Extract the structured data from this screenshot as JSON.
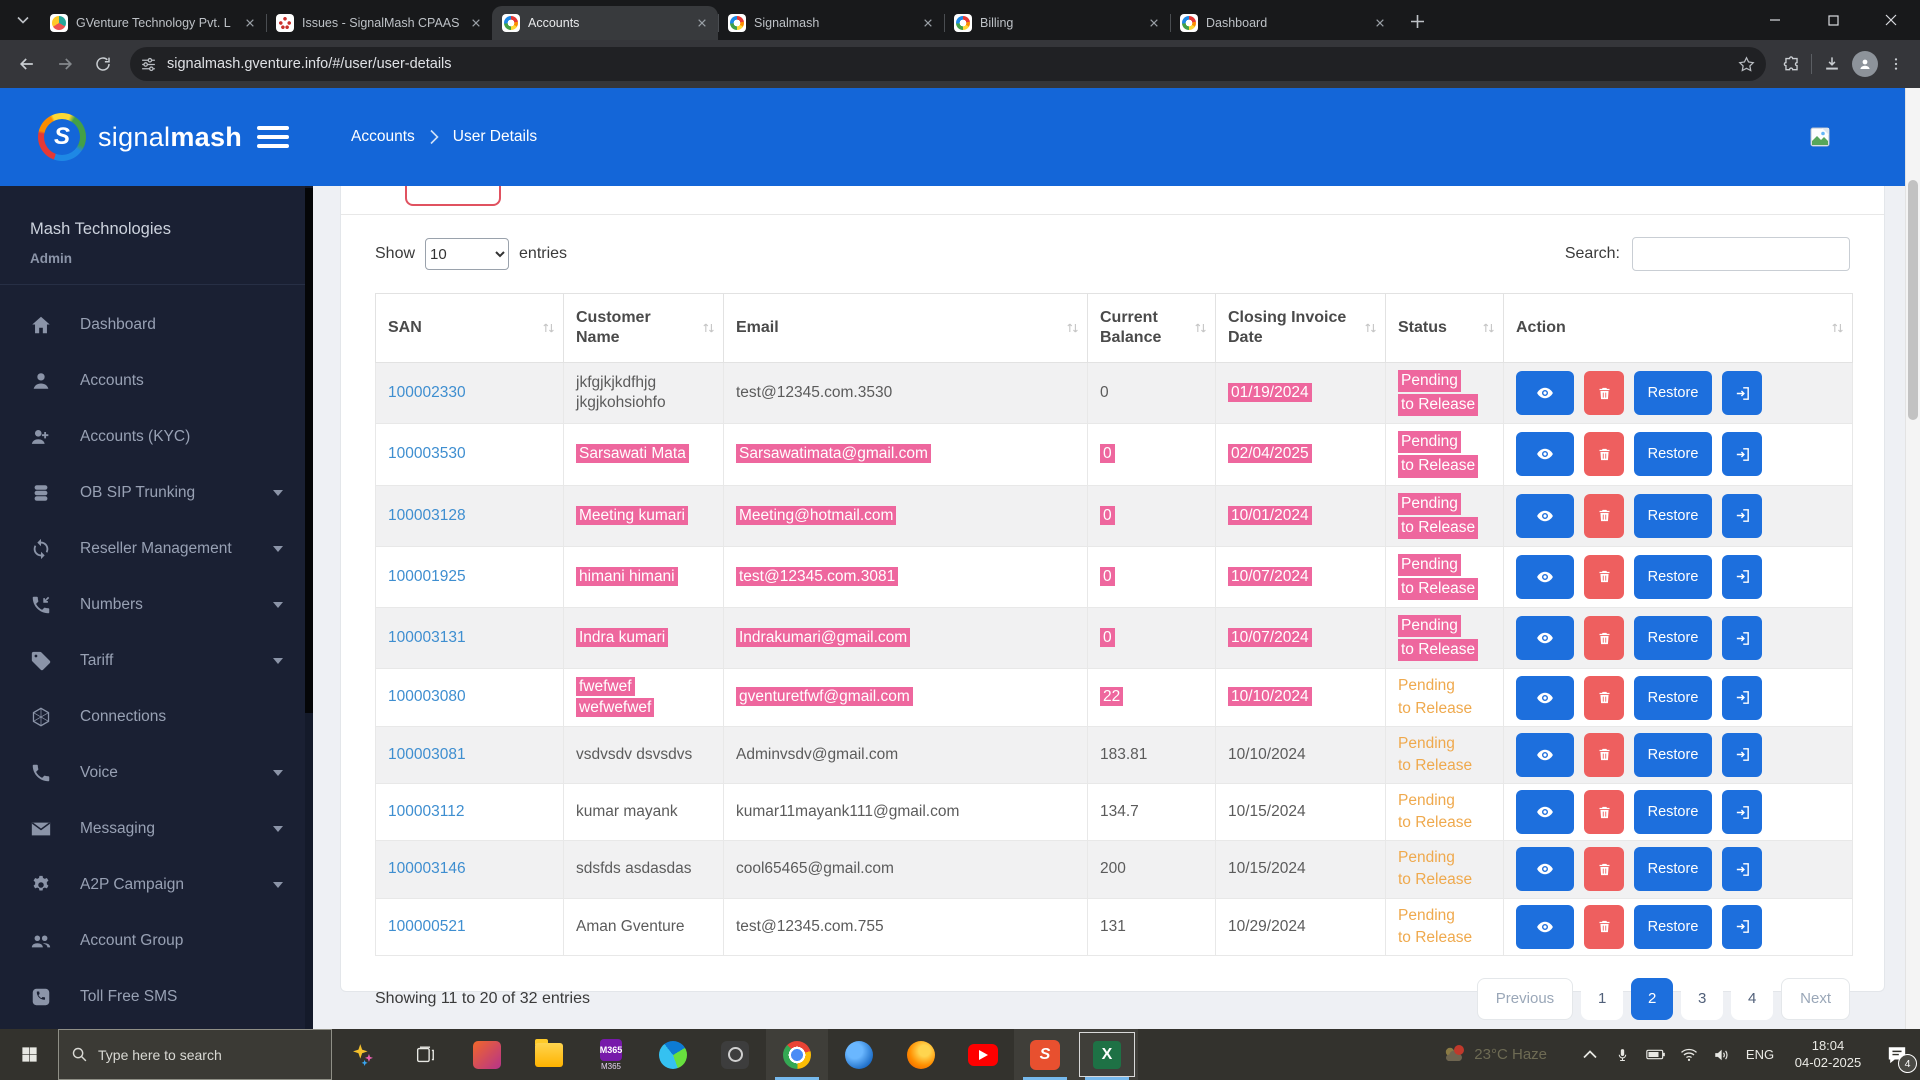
{
  "browser": {
    "url": "signalmash.gventure.info/#/user/user-details",
    "tabs": [
      {
        "title": "GVenture Technology Pvt. L",
        "icon": "gventure-favicon",
        "active": false
      },
      {
        "title": "Issues - SignalMash CPAAS",
        "icon": "redmine-favicon",
        "active": false
      },
      {
        "title": "Accounts",
        "icon": "signalmash-favicon",
        "active": true
      },
      {
        "title": "Signalmash",
        "icon": "signalmash-favicon",
        "active": false
      },
      {
        "title": "Billing",
        "icon": "signalmash-favicon",
        "active": false
      },
      {
        "title": "Dashboard",
        "icon": "signalmash-favicon",
        "active": false
      }
    ]
  },
  "header": {
    "brand_signal": "signal",
    "brand_mash": "mash",
    "breadcrumb": {
      "parent": "Accounts",
      "current": "User Details"
    }
  },
  "sidebar": {
    "org": "Mash Technologies",
    "role": "Admin",
    "items": [
      {
        "label": "Dashboard",
        "icon": "home-icon",
        "caret": false
      },
      {
        "label": "Accounts",
        "icon": "user-icon",
        "caret": false
      },
      {
        "label": "Accounts (KYC)",
        "icon": "user-plus-icon",
        "caret": false
      },
      {
        "label": "OB SIP Trunking",
        "icon": "database-icon",
        "caret": true
      },
      {
        "label": "Reseller Management",
        "icon": "sync-icon",
        "caret": true
      },
      {
        "label": "Numbers",
        "icon": "phone-incoming-icon",
        "caret": true
      },
      {
        "label": "Tariff",
        "icon": "tag-icon",
        "caret": true
      },
      {
        "label": "Connections",
        "icon": "hexagon-icon",
        "caret": false
      },
      {
        "label": "Voice",
        "icon": "phone-icon",
        "caret": true
      },
      {
        "label": "Messaging",
        "icon": "envelope-icon",
        "caret": true
      },
      {
        "label": "A2P Campaign",
        "icon": "gear-icon",
        "caret": true
      },
      {
        "label": "Account Group",
        "icon": "users-icon",
        "caret": false
      },
      {
        "label": "Toll Free SMS",
        "icon": "phone-square-icon",
        "caret": false
      }
    ]
  },
  "panel": {
    "show_label": "Show",
    "page_size": "10",
    "entries_label": "entries",
    "search_label": "Search:",
    "search_value": ""
  },
  "table": {
    "headers": [
      "SAN",
      "Customer Name",
      "Email",
      "Current Balance",
      "Closing Invoice Date",
      "Status",
      "Action"
    ],
    "restore_label": "Restore",
    "status_lines": [
      "Pending",
      "to Release"
    ],
    "rows": [
      {
        "san": "100002330",
        "name": "jkfgjkjkdfhjg jkgjkohsiohfo",
        "email": "test@12345.com.3530",
        "balance": "0",
        "date": "01/19/2024",
        "status": "Pending to Release",
        "hl": {
          "name": false,
          "email": false,
          "balance": false,
          "date": true,
          "status": true
        }
      },
      {
        "san": "100003530",
        "name": "Sarsawati Mata",
        "email": "Sarsawatimata@gmail.com",
        "balance": "0",
        "date": "02/04/2025",
        "status": "Pending to Release",
        "hl": {
          "name": true,
          "email": true,
          "balance": true,
          "date": true,
          "status": true
        }
      },
      {
        "san": "100003128",
        "name": "Meeting kumari",
        "email": "Meeting@hotmail.com",
        "balance": "0",
        "date": "10/01/2024",
        "status": "Pending to Release",
        "hl": {
          "name": true,
          "email": true,
          "balance": true,
          "date": true,
          "status": true
        }
      },
      {
        "san": "100001925",
        "name": "himani himani",
        "email": "test@12345.com.3081",
        "balance": "0",
        "date": "10/07/2024",
        "status": "Pending to Release",
        "hl": {
          "name": true,
          "email": true,
          "balance": true,
          "date": true,
          "status": true
        }
      },
      {
        "san": "100003131",
        "name": "Indra kumari",
        "email": "Indrakumari@gmail.com",
        "balance": "0",
        "date": "10/07/2024",
        "status": "Pending to Release",
        "hl": {
          "name": true,
          "email": true,
          "balance": true,
          "date": true,
          "status": true
        }
      },
      {
        "san": "100003080",
        "name": "fwefwef wefwefwef",
        "email": "gventuretfwf@gmail.com",
        "balance": "22",
        "date": "10/10/2024",
        "status": "Pending to Release",
        "hl": {
          "name": true,
          "email": true,
          "balance": true,
          "date": true,
          "status": false
        }
      },
      {
        "san": "100003081",
        "name": "vsdvsdv dsvsdvs",
        "email": "Adminvsdv@gmail.com",
        "balance": "183.81",
        "date": "10/10/2024",
        "status": "Pending to Release",
        "hl": {
          "name": false,
          "email": false,
          "balance": false,
          "date": false,
          "status": false
        }
      },
      {
        "san": "100003112",
        "name": "kumar mayank",
        "email": "kumar11mayank111@gmail.com",
        "balance": "134.7",
        "date": "10/15/2024",
        "status": "Pending to Release",
        "hl": {
          "name": false,
          "email": false,
          "balance": false,
          "date": false,
          "status": false
        }
      },
      {
        "san": "100003146",
        "name": "sdsfds asdasdas",
        "email": "cool65465@gmail.com",
        "balance": "200",
        "date": "10/15/2024",
        "status": "Pending to Release",
        "hl": {
          "name": false,
          "email": false,
          "balance": false,
          "date": false,
          "status": false
        }
      },
      {
        "san": "100000521",
        "name": "Aman Gventure",
        "email": "test@12345.com.755",
        "balance": "131",
        "date": "10/29/2024",
        "status": "Pending to Release",
        "hl": {
          "name": false,
          "email": false,
          "balance": false,
          "date": false,
          "status": false
        }
      }
    ]
  },
  "footer": {
    "summary": "Showing 11 to 20 of 32 entries",
    "pages": [
      {
        "label": "Previous",
        "kind": "nav",
        "active": false
      },
      {
        "label": "1",
        "kind": "num",
        "active": false
      },
      {
        "label": "2",
        "kind": "num",
        "active": true
      },
      {
        "label": "3",
        "kind": "num",
        "active": false
      },
      {
        "label": "4",
        "kind": "num",
        "active": false
      },
      {
        "label": "Next",
        "kind": "nav",
        "active": false
      }
    ]
  },
  "taskbar": {
    "search_placeholder": "Type here to search",
    "apps": [
      {
        "name": "cortana-sparkle-icon",
        "active": false,
        "focused": false
      },
      {
        "name": "task-view-icon",
        "active": false,
        "focused": false
      },
      {
        "name": "photos-app-icon",
        "active": false,
        "focused": false
      },
      {
        "name": "file-explorer-icon",
        "active": false,
        "focused": false
      },
      {
        "name": "m365-app-icon",
        "active": false,
        "focused": false
      },
      {
        "name": "edge-app-icon",
        "active": false,
        "focused": false
      },
      {
        "name": "camera-app-icon",
        "active": false,
        "focused": false
      },
      {
        "name": "chrome-app-icon",
        "active": true,
        "focused": false
      },
      {
        "name": "onedrive-app-icon",
        "active": false,
        "focused": false
      },
      {
        "name": "firefox-app-icon",
        "active": false,
        "focused": false
      },
      {
        "name": "youtube-app-icon",
        "active": false,
        "focused": false
      },
      {
        "name": "signalmash-app-icon",
        "active": true,
        "focused": false
      },
      {
        "name": "excel-app-icon",
        "active": true,
        "focused": true
      }
    ],
    "app_glyphs": {
      "m365": "M365",
      "excel": "X",
      "signalmash": "S"
    },
    "weather": "23°C Haze",
    "lang": "ENG",
    "time": "18:04",
    "date": "04-02-2025",
    "notification_count": "4"
  },
  "colors": {
    "header_blue": "#1466d8",
    "sidebar_bg": "#1a2033",
    "highlight_pink": "#ee679e",
    "status_orange": "#efa94d",
    "primary_blue": "#1d6fdd",
    "danger_red": "#ee5f5f"
  }
}
